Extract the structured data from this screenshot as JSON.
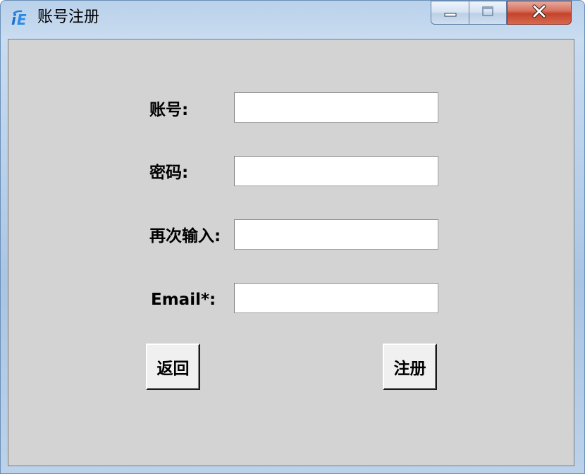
{
  "window": {
    "title": "账号注册",
    "app_icon": "ie-logo-icon"
  },
  "title_controls": {
    "minimize": "minimize-icon",
    "maximize": "maximize-icon",
    "close": "close-icon",
    "close_color": "#c7432c"
  },
  "form": {
    "account_label": "账号:",
    "account_value": "",
    "password_label": "密码:",
    "password_value": "",
    "confirm_label": "再次输入:",
    "confirm_value": "",
    "email_label": "Email*:",
    "email_value": ""
  },
  "buttons": {
    "back": "返回",
    "register": "注册"
  },
  "colors": {
    "client_bg": "#d4d3d3",
    "titlebar": "#bcd3ec"
  }
}
